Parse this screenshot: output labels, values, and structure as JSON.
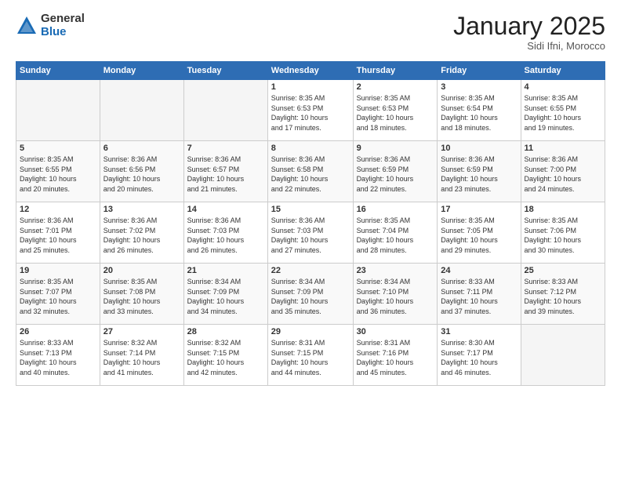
{
  "logo": {
    "general": "General",
    "blue": "Blue"
  },
  "title": "January 2025",
  "location": "Sidi Ifni, Morocco",
  "days_of_week": [
    "Sunday",
    "Monday",
    "Tuesday",
    "Wednesday",
    "Thursday",
    "Friday",
    "Saturday"
  ],
  "weeks": [
    [
      {
        "day": "",
        "info": ""
      },
      {
        "day": "",
        "info": ""
      },
      {
        "day": "",
        "info": ""
      },
      {
        "day": "1",
        "info": "Sunrise: 8:35 AM\nSunset: 6:53 PM\nDaylight: 10 hours\nand 17 minutes."
      },
      {
        "day": "2",
        "info": "Sunrise: 8:35 AM\nSunset: 6:53 PM\nDaylight: 10 hours\nand 18 minutes."
      },
      {
        "day": "3",
        "info": "Sunrise: 8:35 AM\nSunset: 6:54 PM\nDaylight: 10 hours\nand 18 minutes."
      },
      {
        "day": "4",
        "info": "Sunrise: 8:35 AM\nSunset: 6:55 PM\nDaylight: 10 hours\nand 19 minutes."
      }
    ],
    [
      {
        "day": "5",
        "info": "Sunrise: 8:35 AM\nSunset: 6:55 PM\nDaylight: 10 hours\nand 20 minutes."
      },
      {
        "day": "6",
        "info": "Sunrise: 8:36 AM\nSunset: 6:56 PM\nDaylight: 10 hours\nand 20 minutes."
      },
      {
        "day": "7",
        "info": "Sunrise: 8:36 AM\nSunset: 6:57 PM\nDaylight: 10 hours\nand 21 minutes."
      },
      {
        "day": "8",
        "info": "Sunrise: 8:36 AM\nSunset: 6:58 PM\nDaylight: 10 hours\nand 22 minutes."
      },
      {
        "day": "9",
        "info": "Sunrise: 8:36 AM\nSunset: 6:59 PM\nDaylight: 10 hours\nand 22 minutes."
      },
      {
        "day": "10",
        "info": "Sunrise: 8:36 AM\nSunset: 6:59 PM\nDaylight: 10 hours\nand 23 minutes."
      },
      {
        "day": "11",
        "info": "Sunrise: 8:36 AM\nSunset: 7:00 PM\nDaylight: 10 hours\nand 24 minutes."
      }
    ],
    [
      {
        "day": "12",
        "info": "Sunrise: 8:36 AM\nSunset: 7:01 PM\nDaylight: 10 hours\nand 25 minutes."
      },
      {
        "day": "13",
        "info": "Sunrise: 8:36 AM\nSunset: 7:02 PM\nDaylight: 10 hours\nand 26 minutes."
      },
      {
        "day": "14",
        "info": "Sunrise: 8:36 AM\nSunset: 7:03 PM\nDaylight: 10 hours\nand 26 minutes."
      },
      {
        "day": "15",
        "info": "Sunrise: 8:36 AM\nSunset: 7:03 PM\nDaylight: 10 hours\nand 27 minutes."
      },
      {
        "day": "16",
        "info": "Sunrise: 8:35 AM\nSunset: 7:04 PM\nDaylight: 10 hours\nand 28 minutes."
      },
      {
        "day": "17",
        "info": "Sunrise: 8:35 AM\nSunset: 7:05 PM\nDaylight: 10 hours\nand 29 minutes."
      },
      {
        "day": "18",
        "info": "Sunrise: 8:35 AM\nSunset: 7:06 PM\nDaylight: 10 hours\nand 30 minutes."
      }
    ],
    [
      {
        "day": "19",
        "info": "Sunrise: 8:35 AM\nSunset: 7:07 PM\nDaylight: 10 hours\nand 32 minutes."
      },
      {
        "day": "20",
        "info": "Sunrise: 8:35 AM\nSunset: 7:08 PM\nDaylight: 10 hours\nand 33 minutes."
      },
      {
        "day": "21",
        "info": "Sunrise: 8:34 AM\nSunset: 7:09 PM\nDaylight: 10 hours\nand 34 minutes."
      },
      {
        "day": "22",
        "info": "Sunrise: 8:34 AM\nSunset: 7:09 PM\nDaylight: 10 hours\nand 35 minutes."
      },
      {
        "day": "23",
        "info": "Sunrise: 8:34 AM\nSunset: 7:10 PM\nDaylight: 10 hours\nand 36 minutes."
      },
      {
        "day": "24",
        "info": "Sunrise: 8:33 AM\nSunset: 7:11 PM\nDaylight: 10 hours\nand 37 minutes."
      },
      {
        "day": "25",
        "info": "Sunrise: 8:33 AM\nSunset: 7:12 PM\nDaylight: 10 hours\nand 39 minutes."
      }
    ],
    [
      {
        "day": "26",
        "info": "Sunrise: 8:33 AM\nSunset: 7:13 PM\nDaylight: 10 hours\nand 40 minutes."
      },
      {
        "day": "27",
        "info": "Sunrise: 8:32 AM\nSunset: 7:14 PM\nDaylight: 10 hours\nand 41 minutes."
      },
      {
        "day": "28",
        "info": "Sunrise: 8:32 AM\nSunset: 7:15 PM\nDaylight: 10 hours\nand 42 minutes."
      },
      {
        "day": "29",
        "info": "Sunrise: 8:31 AM\nSunset: 7:15 PM\nDaylight: 10 hours\nand 44 minutes."
      },
      {
        "day": "30",
        "info": "Sunrise: 8:31 AM\nSunset: 7:16 PM\nDaylight: 10 hours\nand 45 minutes."
      },
      {
        "day": "31",
        "info": "Sunrise: 8:30 AM\nSunset: 7:17 PM\nDaylight: 10 hours\nand 46 minutes."
      },
      {
        "day": "",
        "info": ""
      }
    ]
  ]
}
